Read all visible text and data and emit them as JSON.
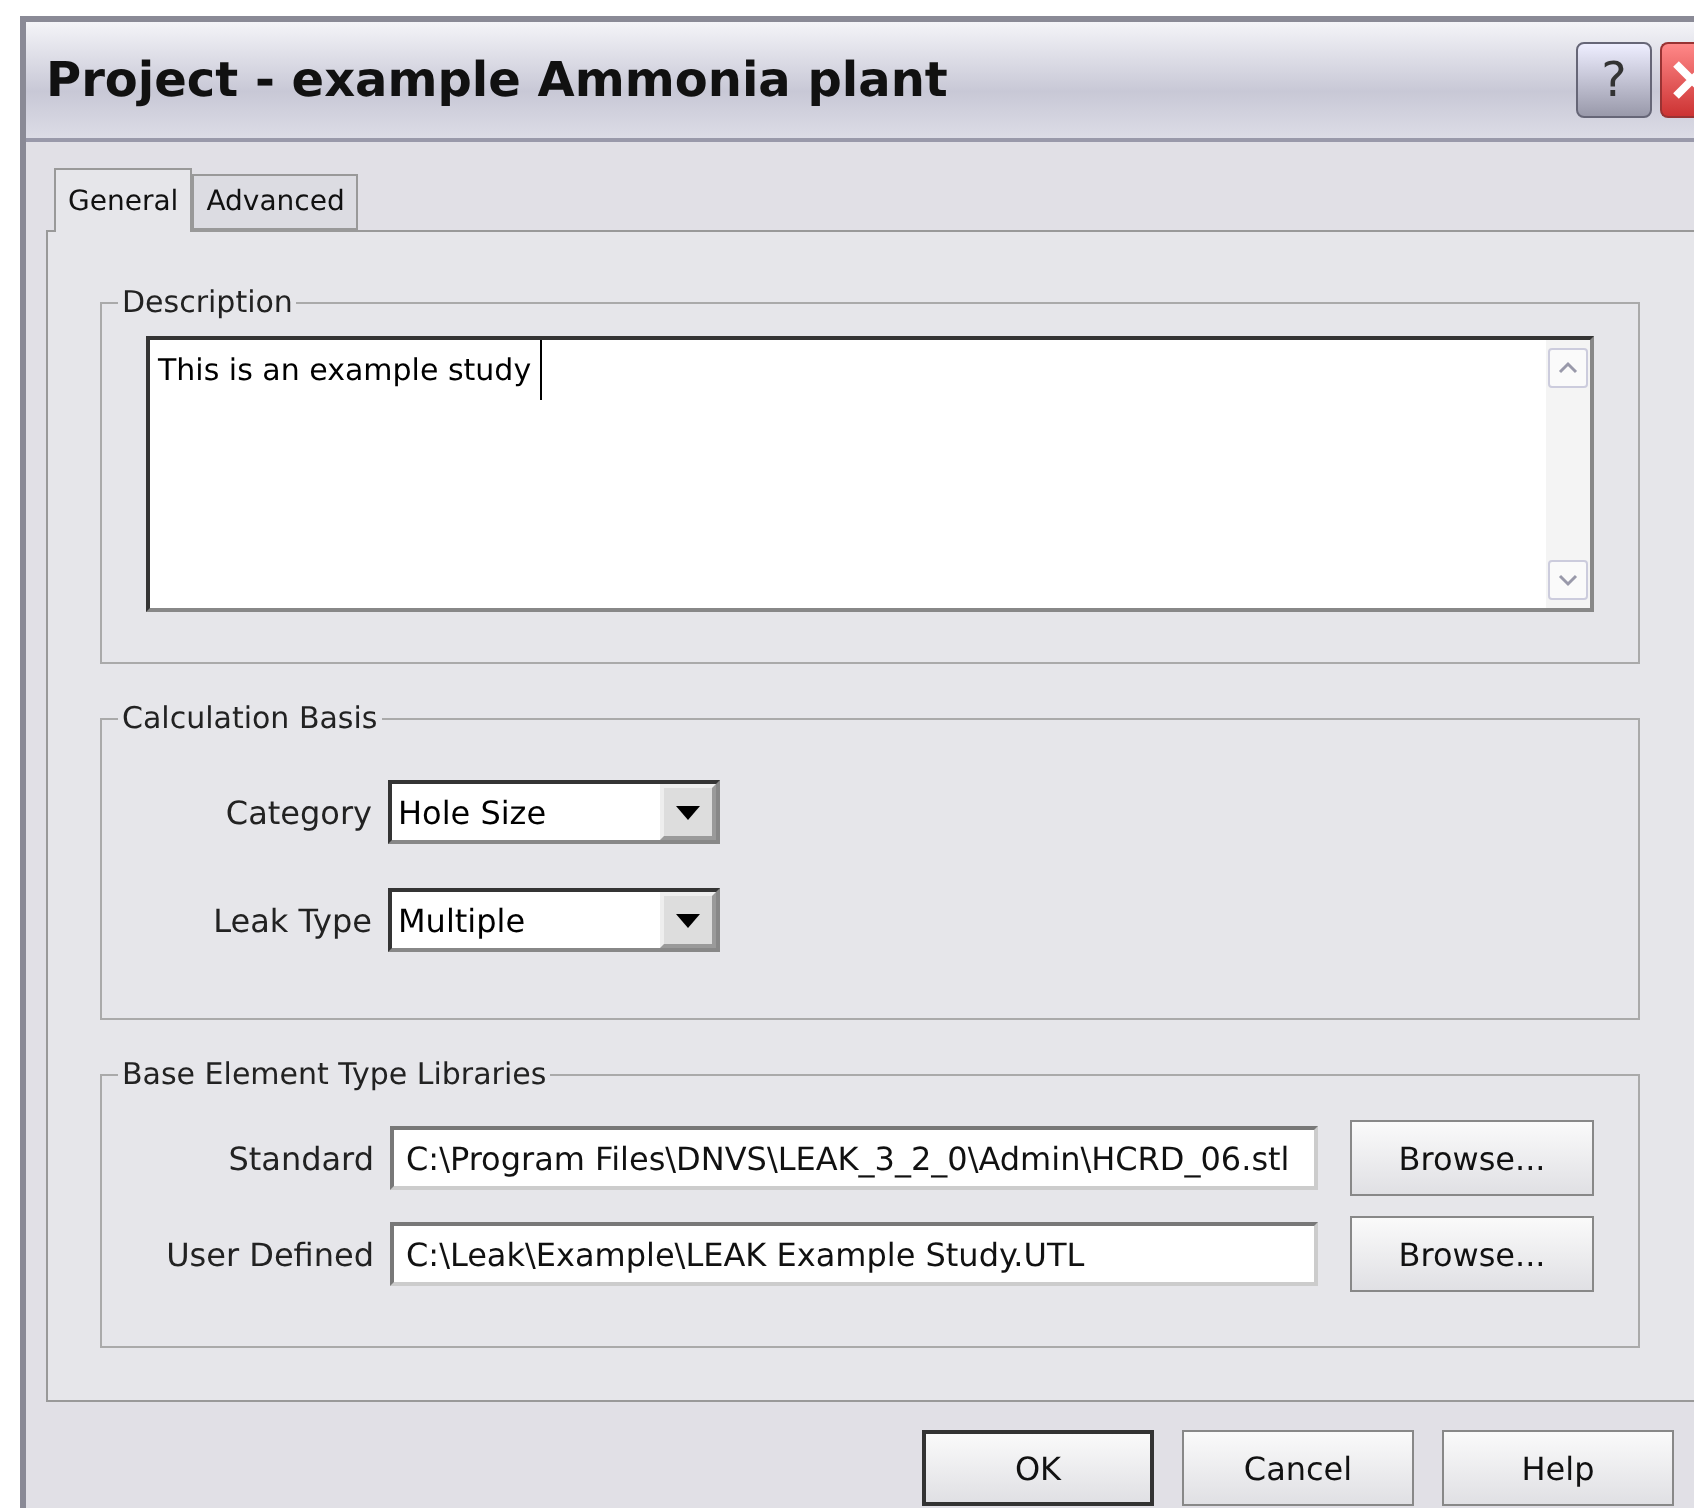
{
  "window": {
    "title": "Project - example Ammonia plant",
    "help_button": "?"
  },
  "tabs": [
    {
      "label": "General",
      "selected": true
    },
    {
      "label": "Advanced",
      "selected": false
    }
  ],
  "description": {
    "legend": "Description",
    "value": "This is an example study"
  },
  "calculation_basis": {
    "legend": "Calculation Basis",
    "fields": [
      {
        "label": "Category",
        "value": "Hole Size"
      },
      {
        "label": "Leak Type",
        "value": "Multiple"
      }
    ]
  },
  "libraries": {
    "legend": "Base Element Type Libraries",
    "rows": [
      {
        "label": "Standard",
        "value": "C:\\Program Files\\DNVS\\LEAK_3_2_0\\Admin\\HCRD_06.stl",
        "button": "Browse..."
      },
      {
        "label": "User Defined",
        "value": "C:\\Leak\\Example\\LEAK Example Study.UTL",
        "button": "Browse..."
      }
    ]
  },
  "buttons": [
    {
      "label": "OK",
      "default": true
    },
    {
      "label": "Cancel",
      "default": false
    },
    {
      "label": "Help",
      "default": false
    }
  ]
}
